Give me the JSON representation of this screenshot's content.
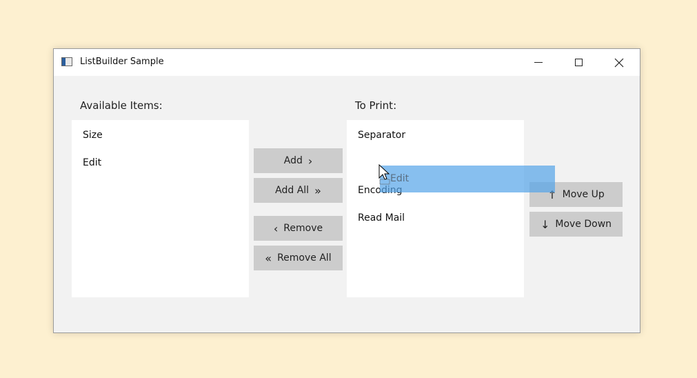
{
  "window": {
    "title": "ListBuilder Sample",
    "icon": "app-window-icon",
    "controls": {
      "minimize": "minimize-icon",
      "maximize": "maximize-icon",
      "close": "close-icon"
    }
  },
  "available": {
    "label": "Available Items:",
    "items": [
      "Size",
      "Edit"
    ]
  },
  "to_print": {
    "label": "To Print:",
    "items": [
      "Separator",
      "Encoding",
      "Read Mail"
    ]
  },
  "buttons": {
    "add": "Add",
    "add_all": "Add All",
    "remove": "Remove",
    "remove_all": "Remove All",
    "move_up": "Move Up",
    "move_down": "Move Down"
  },
  "glyphs": {
    "add": "›",
    "add_all": "»",
    "remove": "‹",
    "remove_all": "«",
    "move_up": "↑",
    "move_down": "↓"
  },
  "drag": {
    "label": "Edit"
  },
  "colors": {
    "background": "#fdf0d0",
    "window_bg": "#f2f2f2",
    "button_bg": "#cccccc",
    "drag_highlight": "#54a4e8"
  }
}
